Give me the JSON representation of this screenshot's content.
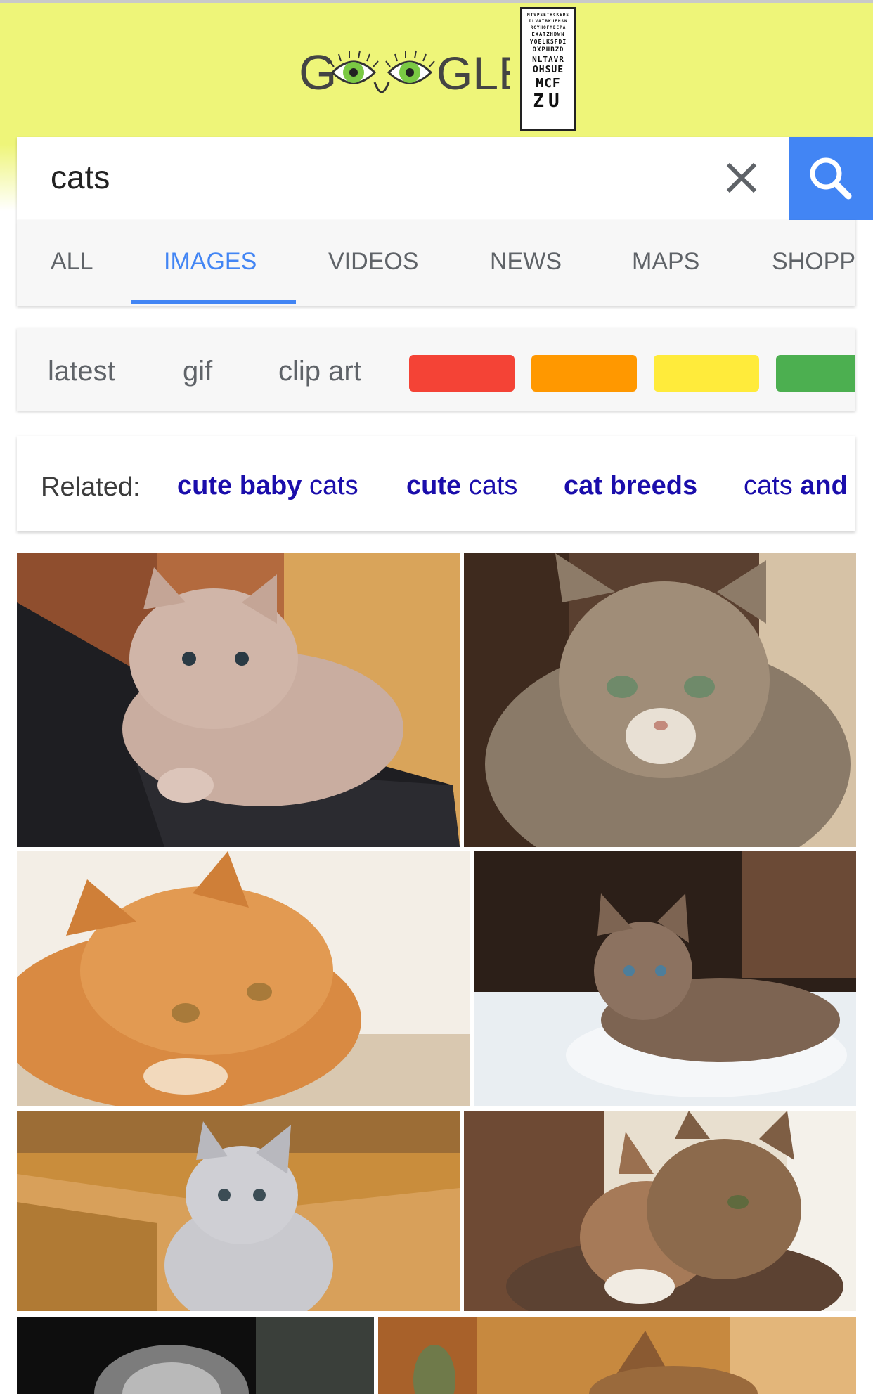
{
  "logo": {
    "text_left": "G",
    "text_right": "GLE",
    "eye_chart_rows": [
      "MTVPSETHCKEDS",
      "DLVATBKUEHSN",
      "RCYHOFMEEPA",
      "EXATZHDWN",
      "YOELKSFDI",
      "OXPHBZD",
      "NLTAVR",
      "OHSUE",
      "MCF",
      "ZU"
    ]
  },
  "search": {
    "query": "cats",
    "clear_icon": "close-icon",
    "search_icon": "search-icon",
    "colors": {
      "button": "#4285f4"
    }
  },
  "tabs": [
    {
      "label": "ALL"
    },
    {
      "label": "IMAGES",
      "active": true
    },
    {
      "label": "VIDEOS"
    },
    {
      "label": "NEWS"
    },
    {
      "label": "MAPS"
    },
    {
      "label": "SHOPP"
    }
  ],
  "filters": {
    "chips": [
      "latest",
      "gif",
      "clip art"
    ],
    "colors": [
      "#f44336",
      "#ff9800",
      "#ffeb3b",
      "#4caf50"
    ]
  },
  "related": {
    "label": "Related:",
    "items": [
      {
        "bold": "cute baby",
        "normal": " cats"
      },
      {
        "bold": "cute",
        "normal": " cats"
      },
      {
        "bold": "cat breeds",
        "normal": ""
      },
      {
        "bold": "and",
        "normal": "cats "
      }
    ]
  },
  "results": {
    "images": [
      "gray kitten on laptop keyboard",
      "tabby cat portrait",
      "orange cat lying down",
      "fluffy kitten on white blanket",
      "gray tabby kitten in cardboard box",
      "two cats cuddling",
      "cat partially visible",
      "cat partially visible"
    ]
  }
}
